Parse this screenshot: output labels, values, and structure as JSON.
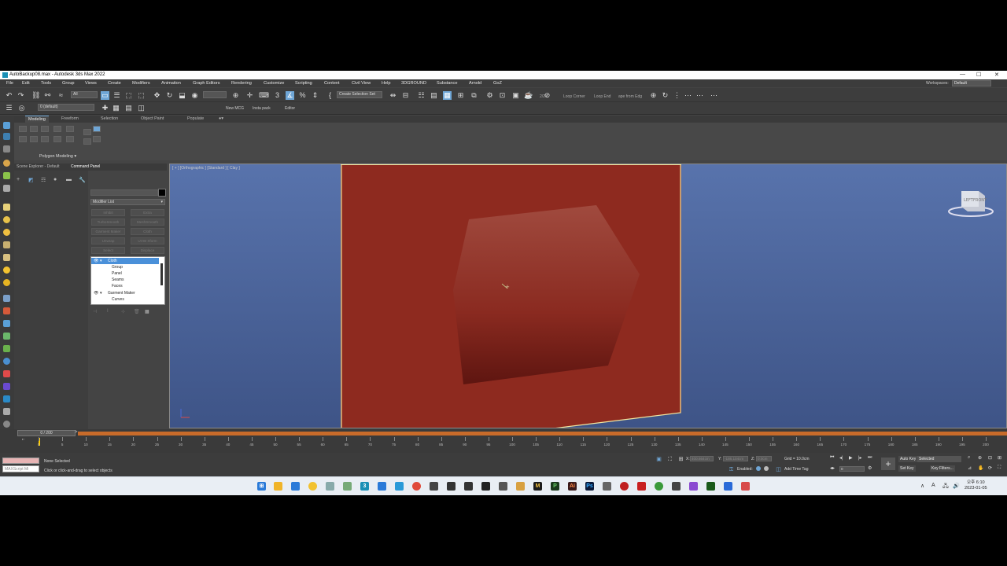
{
  "window": {
    "title": "AutoBackup08.max - Autodesk 3ds Max 2022",
    "minimize": "—",
    "maximize": "☐",
    "close": "✕"
  },
  "menu": {
    "items": [
      "File",
      "Edit",
      "Tools",
      "Group",
      "Views",
      "Create",
      "Modifiers",
      "Animation",
      "Graph Editors",
      "Rendering",
      "Customize",
      "Scripting",
      "Content",
      "Civil View",
      "Help",
      "3DGROUND",
      "Substance",
      "Arnold",
      "GoZ"
    ],
    "workspaces_label": "Workspaces:",
    "workspace_value": "Default"
  },
  "toolbar": {
    "filter_value": "All",
    "create_selection_set": "Create Selection Set",
    "loop_buttons": [
      "2/20",
      "Loop Corner",
      "Loop End",
      "ape from Edg"
    ],
    "layer_value": "0 (default)",
    "axis_x": "X",
    "axis_y": "Y",
    "axis_z": "Z",
    "axis_xy": "XY",
    "axis_xy2": "XY",
    "script_buttons": [
      "New MCG",
      "Insta pack",
      "Editor"
    ]
  },
  "ribbon": {
    "tabs": [
      "Modeling",
      "Freeform",
      "Selection",
      "Object Paint",
      "Populate"
    ],
    "active_tab": "Modeling",
    "panel_label": "Polygon Modeling ▾"
  },
  "command_panel": {
    "tabs": [
      "Scene Explorer - Default",
      "Command Panel"
    ],
    "modifier_list": "Modifier List",
    "modifier_buttons": [
      "Inhibit",
      "Extra",
      "TurboSmooth",
      "MeshSmooth",
      "Garment Maker",
      "Cloth",
      "Unwrap",
      "UVW Xform",
      "Select",
      "Displace"
    ],
    "stack": [
      {
        "label": "Cloth",
        "level": 0,
        "selected": true,
        "expanded": true
      },
      {
        "label": "Group",
        "level": 1,
        "selected": false
      },
      {
        "label": "Panel",
        "level": 1,
        "selected": false
      },
      {
        "label": "Seams",
        "level": 1,
        "selected": false
      },
      {
        "label": "Faces",
        "level": 1,
        "selected": false
      },
      {
        "label": "Garment Maker",
        "level": 0,
        "selected": false,
        "expanded": true
      },
      {
        "label": "Curves",
        "level": 1,
        "selected": false
      }
    ]
  },
  "viewport": {
    "label": "[ + ] [Orthographic ] [Standard ] [ Clay ]",
    "viewcube_label": "FRONT",
    "viewcube_side": "LEFT",
    "cloth_color": "#8e2a1f",
    "bg_top": "#5873ac",
    "bg_bottom": "#3e5487"
  },
  "timeline": {
    "frame_display": "0 / 200",
    "ticks": [
      0,
      5,
      10,
      15,
      20,
      25,
      30,
      35,
      40,
      45,
      50,
      55,
      60,
      65,
      70,
      75,
      80,
      85,
      90,
      95,
      100,
      105,
      110,
      115,
      120,
      125,
      130,
      135,
      140,
      145,
      150,
      155,
      160,
      165,
      170,
      175,
      180,
      185,
      190,
      195,
      200
    ],
    "max_frame": 200
  },
  "status": {
    "maxscript_label": "MAXScript Mi",
    "selection": "None Selected",
    "prompt": "Click or click-and-drag to select objects",
    "x_label": "X:",
    "x_value": "400.664cm",
    "y_label": "Y:",
    "y_value": "-186.104cm",
    "z_label": "Z:",
    "z_value": "0.0cm",
    "grid": "Grid = 10.0cm",
    "enabled": "Enabled:",
    "add_time_tag": "Add Time Tag",
    "auto_key": "Auto Key",
    "selected": "Selected",
    "set_key": "Set Key",
    "key_filters": "Key Filters...",
    "current_frame": "0"
  },
  "taskbar": {
    "time": "오후 6:10",
    "date": "2023-01-05"
  }
}
